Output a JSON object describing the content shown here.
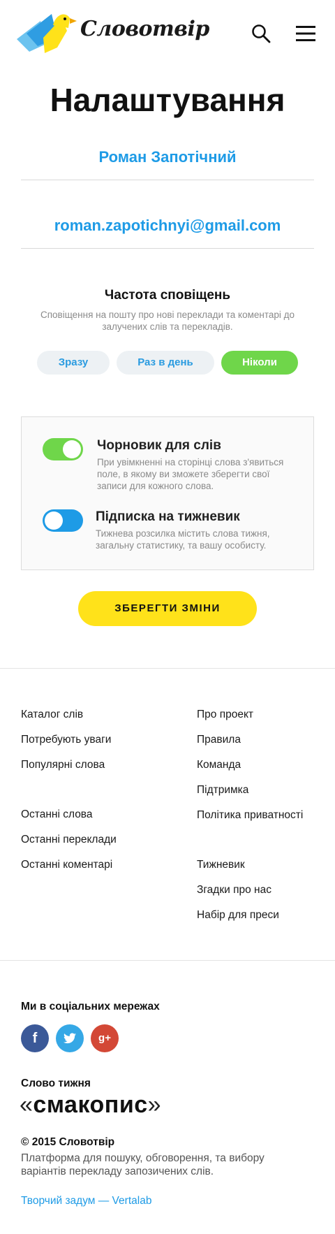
{
  "header": {
    "logo_text": "Словотвір",
    "logo_alt": "bird-logo",
    "search_icon": "search-icon",
    "menu_icon": "hamburger-menu-icon"
  },
  "page": {
    "title": "Налаштування",
    "name_value": "Роман Запотічний",
    "email_value": "roman.zapotichnyi@gmail.com"
  },
  "notifications": {
    "title": "Частота сповіщень",
    "description": "Сповіщення на пошту про нові переклади та коментарі до залучених слів та перекладів.",
    "options": [
      {
        "label": "Зразу",
        "selected": false
      },
      {
        "label": "Раз в день",
        "selected": false
      },
      {
        "label": "Ніколи",
        "selected": true
      }
    ]
  },
  "settings": {
    "drafts": {
      "title": "Чорновик для слів",
      "description": "При увімкненні на сторінці слова з'явиться поле, в якому ви зможете зберегти свої записи для кожного слова.",
      "enabled": true
    },
    "newsletter": {
      "title": "Підписка на тижневик",
      "description": "Тижнева розсилка містить слова тижня, загальну статистику, та вашу особисту.",
      "enabled": false
    }
  },
  "save_label": "ЗБЕРЕГТИ ЗМІНИ",
  "footer": {
    "left_links": [
      "Каталог слів",
      "Потребують уваги",
      "Популярні слова",
      "Останні слова",
      "Останні переклади",
      "Останні коментарі"
    ],
    "right_links": [
      "Про проект",
      "Правила",
      "Команда",
      "Підтримка",
      "Політика приватності",
      "Тижневик",
      "Згадки про нас",
      "Набір для преси"
    ],
    "social_title": "Ми в соціальних мережах",
    "social": [
      {
        "name": "facebook",
        "glyph": "f",
        "color": "#3b5998"
      },
      {
        "name": "twitter",
        "glyph": "t",
        "color": "#35a8e6"
      },
      {
        "name": "google-plus",
        "glyph": "g+",
        "color": "#d34836"
      }
    ],
    "word_label": "Слово тижня",
    "word_of_week": "смакопис",
    "quote_open": "«",
    "quote_close": "»",
    "copyright": "© 2015 Словотвір",
    "platform_desc": "Платформа для пошуку, обговорення, та вибору варіантів перекладу запозичених слів.",
    "credit": "Творчий задум — Vertalab"
  },
  "colors": {
    "accent_blue": "#1e9be6",
    "accent_green": "#6fd64a",
    "accent_yellow": "#ffe21a"
  }
}
